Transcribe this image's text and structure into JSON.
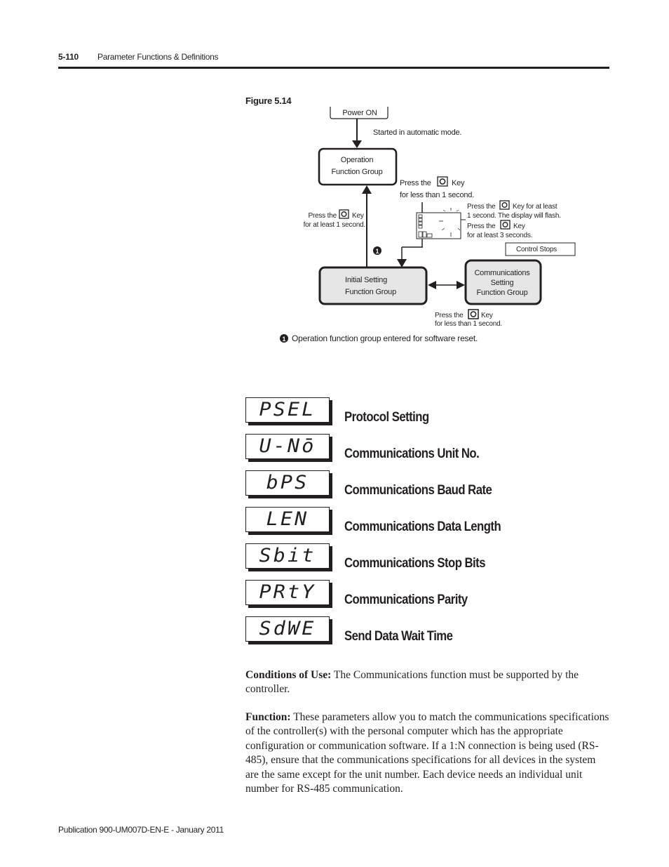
{
  "header": {
    "page_number": "5-110",
    "section_title": "Parameter Functions & Definitions"
  },
  "figure": {
    "label": "Figure 5.14",
    "nodes": {
      "power_on": "Power ON",
      "operation_group": [
        "Operation",
        "Function Group"
      ],
      "initial_setting_group": [
        "Initial Setting",
        "Function Group"
      ],
      "communications_group": [
        "Communications",
        "Setting",
        "Function Group"
      ],
      "control_stops": "Control Stops"
    },
    "annotations": {
      "started_auto": "Started in automatic mode.",
      "press_less_1s_top": [
        "Press the",
        "Key",
        "for less than 1 second."
      ],
      "press_at_least_1s_left": [
        "Press the",
        "Key",
        "for at least 1 second."
      ],
      "press_flash": [
        "Press the",
        "Key for at least",
        "1 second. The display will flash."
      ],
      "press_3s": [
        "Press the",
        "Key",
        "for at least 3 seconds."
      ],
      "press_less_1s_bottom": [
        "Press the",
        "Key",
        "for less than 1 second."
      ],
      "marker_1": "1"
    },
    "footnote": {
      "marker": "1",
      "text": "Operation function group entered for software reset."
    },
    "icons": {
      "key": "mode-key-icon",
      "display": "controller-display-icon"
    }
  },
  "parameters": [
    {
      "display": "PSEL",
      "label": "Protocol Setting"
    },
    {
      "display": "U-Nō",
      "label": "Communications Unit No."
    },
    {
      "display": "bPS",
      "label": "Communications Baud Rate"
    },
    {
      "display": "LEN",
      "label": "Communications Data Length"
    },
    {
      "display": "Sbit",
      "label": "Communications Stop Bits"
    },
    {
      "display": "PRtY",
      "label": "Communications Parity"
    },
    {
      "display": "SdWE",
      "label": "Send Data Wait Time"
    }
  ],
  "body": {
    "conditions_label": "Conditions of Use:",
    "conditions_text": " The Communications function must be supported by the controller.",
    "function_label": "Function:",
    "function_text": " These parameters allow you to match the communications specifications of the controller(s) with the personal computer which has the appropriate configuration or communication software. If a 1:N connection is being used (RS-485), ensure that the communications specifications for all devices in the system are the same except for the unit number. Each device needs an individual unit number for RS-485 communication."
  },
  "footer": {
    "publication": "Publication 900-UM007D-EN-E - January 2011"
  }
}
